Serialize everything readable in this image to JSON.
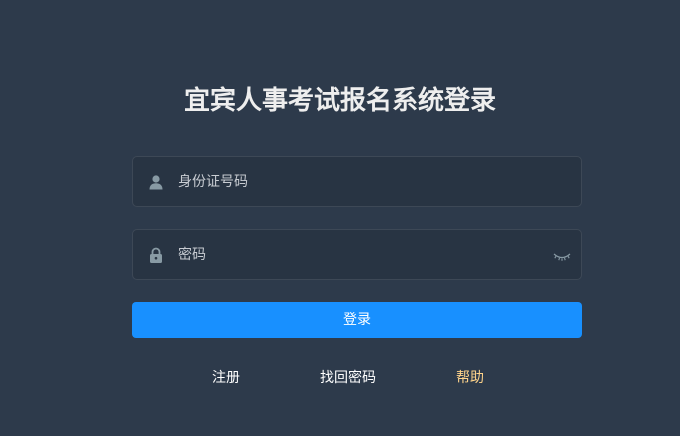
{
  "page": {
    "title": "宜宾人事考试报名系统登录"
  },
  "form": {
    "id_placeholder": "身份证号码",
    "password_placeholder": "密码",
    "login_label": "登录"
  },
  "links": {
    "register": "注册",
    "recover_password": "找回密码",
    "help": "帮助"
  },
  "icons": {
    "user": "user-icon",
    "lock": "lock-icon",
    "eye": "eye-closed-icon"
  },
  "colors": {
    "background": "#2d3a4b",
    "input_background": "#283443",
    "primary": "#1890ff",
    "help_link": "#ffd48b"
  }
}
